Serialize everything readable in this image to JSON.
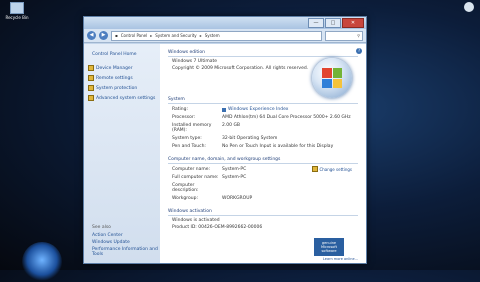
{
  "desktop": {
    "icon_label": "Recycle Bin"
  },
  "window": {
    "minimize": "—",
    "maximize": "□",
    "close": "✕"
  },
  "nav": {
    "address": [
      "Control Panel",
      "System and Security",
      "System"
    ],
    "search_placeholder": "Search"
  },
  "sidebar": {
    "home": "Control Panel Home",
    "items": [
      "Device Manager",
      "Remote settings",
      "System protection",
      "Advanced system settings"
    ],
    "see_also": "See also",
    "see_also_items": [
      "Action Center",
      "Windows Update",
      "Performance Information and Tools"
    ]
  },
  "edition": {
    "title": "Windows edition",
    "name": "Windows 7 Ultimate",
    "copyright": "Copyright © 2009 Microsoft Corporation. All rights reserved."
  },
  "system": {
    "title": "System",
    "rows": [
      {
        "label": "Rating:",
        "value": "Windows Experience Index"
      },
      {
        "label": "Processor:",
        "value": "AMD Athlon(tm) 64 Dual Core Processor 5000+ 2.60 GHz"
      },
      {
        "label": "Installed memory (RAM):",
        "value": "2.00 GB"
      },
      {
        "label": "System type:",
        "value": "32-bit Operating System"
      },
      {
        "label": "Pen and Touch:",
        "value": "No Pen or Touch Input is available for this Display"
      }
    ]
  },
  "computer": {
    "title": "Computer name, domain, and workgroup settings",
    "change": "Change settings",
    "rows": [
      {
        "label": "Computer name:",
        "value": "System-PC"
      },
      {
        "label": "Full computer name:",
        "value": "System-PC"
      },
      {
        "label": "Computer description:",
        "value": ""
      },
      {
        "label": "Workgroup:",
        "value": "WORKGROUP"
      }
    ]
  },
  "activation": {
    "title": "Windows activation",
    "status": "Windows is activated",
    "product_id": "Product ID: 00426-OEM-8992662-00006",
    "badge": "genuine Microsoft software",
    "learn": "Learn more online..."
  },
  "colors": {
    "link": "#1f4e92",
    "section_title": "#1f3e78"
  }
}
